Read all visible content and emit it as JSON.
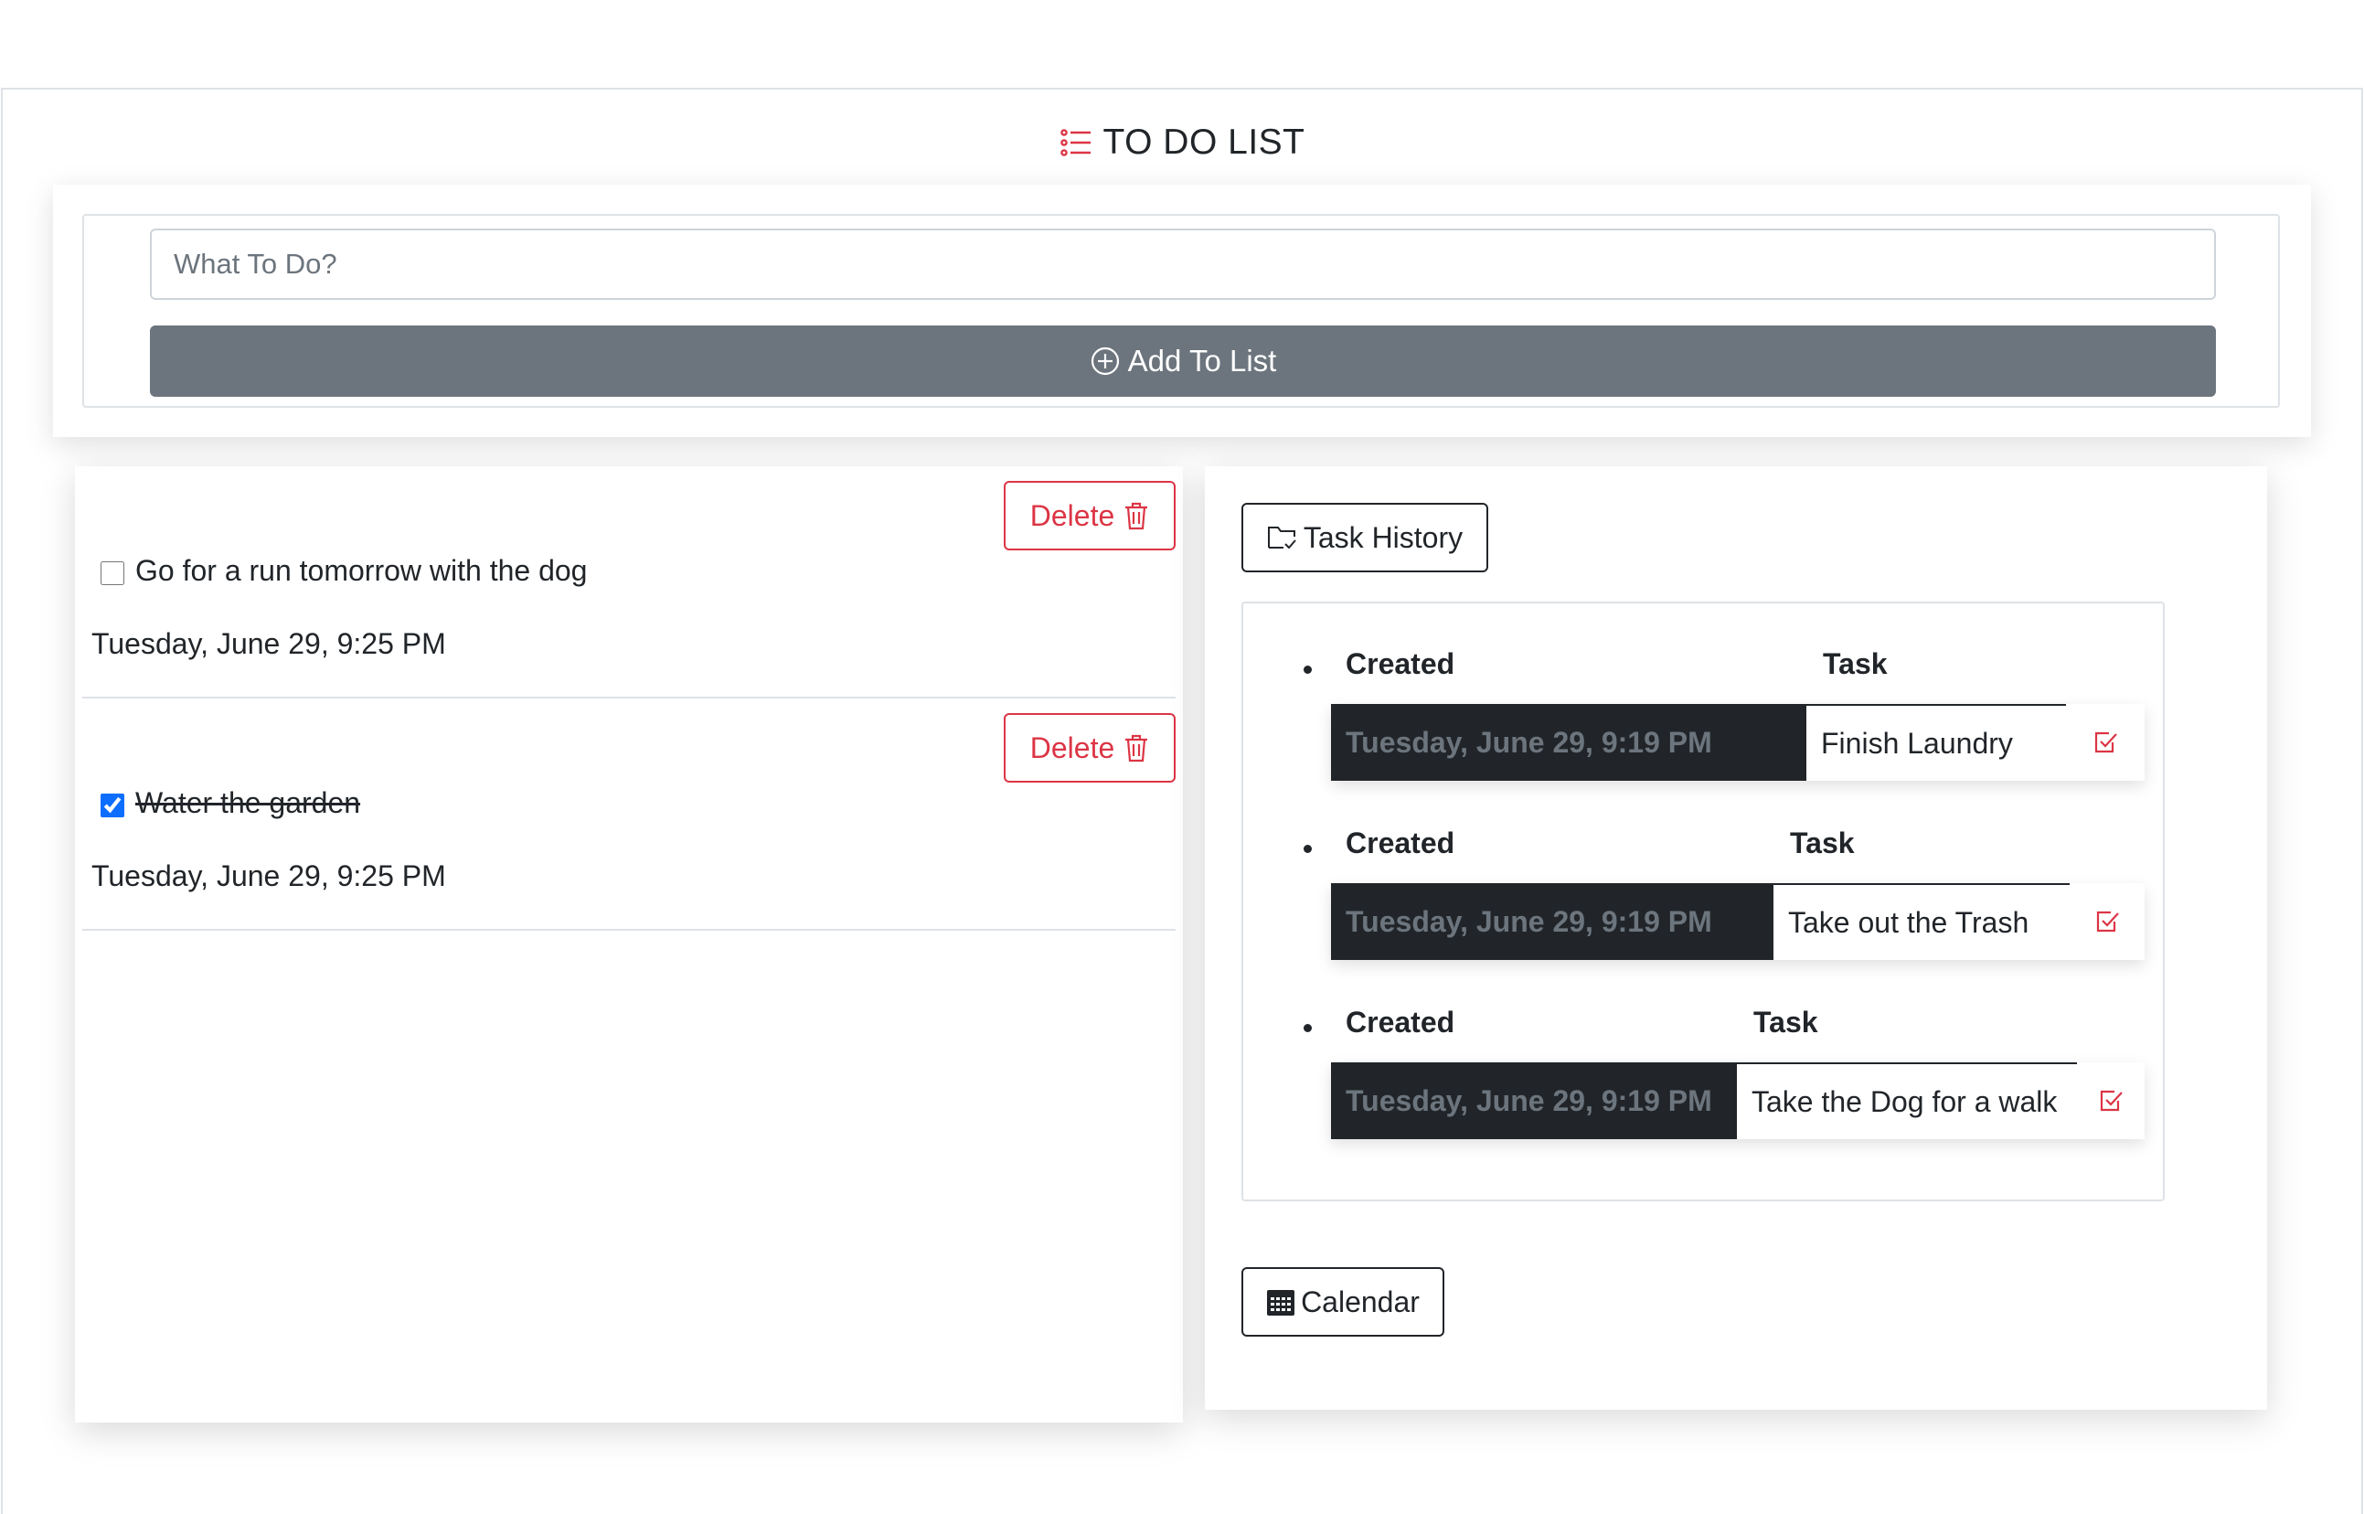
{
  "app": {
    "title": "TO DO LIST"
  },
  "add_form": {
    "placeholder": "What To Do?",
    "value": "",
    "add_label": "Add To List"
  },
  "tasks": [
    {
      "text": "Go for a run tomorrow with the dog",
      "date": "Tuesday, June 29, 9:25 PM",
      "completed": false,
      "delete_label": "Delete"
    },
    {
      "text": "Water the garden",
      "date": "Tuesday, June 29, 9:25 PM",
      "completed": true,
      "delete_label": "Delete"
    }
  ],
  "history": {
    "button_label": "Task History",
    "created_header": "Created",
    "task_header": "Task",
    "entries": [
      {
        "created": "Tuesday, June 29, 9:19 PM",
        "task": "Finish Laundry"
      },
      {
        "created": "Tuesday, June 29, 9:19 PM",
        "task": "Take out the Trash"
      },
      {
        "created": "Tuesday, June 29, 9:19 PM",
        "task": "Take the Dog for a walk"
      }
    ]
  },
  "calendar": {
    "button_label": "Calendar"
  },
  "colors": {
    "accent_red": "#dc3545",
    "button_gray": "#6c757d",
    "dark": "#212529",
    "check_blue": "#0d6efd"
  },
  "icons": {
    "title": "list-icon",
    "add": "plus-circle-icon",
    "delete": "trash-icon",
    "history": "folder-check-icon",
    "history_entry": "check-square-icon",
    "calendar": "calendar-icon"
  }
}
